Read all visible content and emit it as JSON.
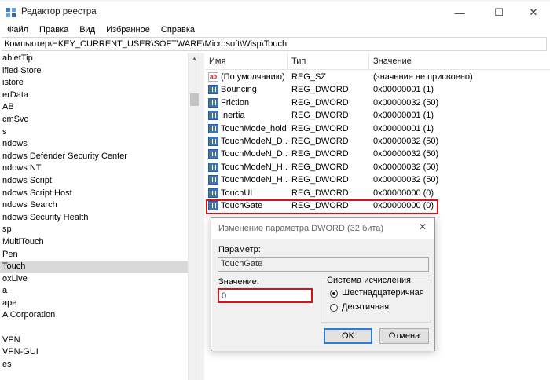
{
  "window": {
    "title": "Редактор реестра",
    "controls": {
      "minimize": "—",
      "maximize": "☐",
      "close": "✕"
    }
  },
  "menu": [
    "Файл",
    "Правка",
    "Вид",
    "Избранное",
    "Справка"
  ],
  "address": "Компьютер\\HKEY_CURRENT_USER\\SOFTWARE\\Microsoft\\Wisp\\Touch",
  "tree": {
    "items": [
      "abletTip",
      "ified Store",
      "istore",
      "erData",
      "AB",
      "cmSvc",
      "s",
      "ndows",
      "ndows Defender Security Center",
      "ndows NT",
      "ndows Script",
      "ndows Script Host",
      "ndows Search",
      "ndows Security Health",
      "sp",
      "MultiTouch",
      "Pen",
      "Touch",
      "oxLive",
      "a",
      "ape",
      "A Corporation",
      "",
      "VPN",
      "VPN-GUI",
      "es"
    ],
    "selected_index": 17
  },
  "list": {
    "headers": {
      "name": "Имя",
      "type": "Тип",
      "value": "Значение"
    },
    "rows": [
      {
        "icon": "string-value-icon",
        "name": "(По умолчанию)",
        "type": "REG_SZ",
        "value": "(значение не присвоено)"
      },
      {
        "icon": "dword-value-icon",
        "name": "Bouncing",
        "type": "REG_DWORD",
        "value": "0x00000001 (1)"
      },
      {
        "icon": "dword-value-icon",
        "name": "Friction",
        "type": "REG_DWORD",
        "value": "0x00000032 (50)"
      },
      {
        "icon": "dword-value-icon",
        "name": "Inertia",
        "type": "REG_DWORD",
        "value": "0x00000001 (1)"
      },
      {
        "icon": "dword-value-icon",
        "name": "TouchMode_hold",
        "type": "REG_DWORD",
        "value": "0x00000001 (1)"
      },
      {
        "icon": "dword-value-icon",
        "name": "TouchModeN_D...",
        "type": "REG_DWORD",
        "value": "0x00000032 (50)"
      },
      {
        "icon": "dword-value-icon",
        "name": "TouchModeN_D...",
        "type": "REG_DWORD",
        "value": "0x00000032 (50)"
      },
      {
        "icon": "dword-value-icon",
        "name": "TouchModeN_H...",
        "type": "REG_DWORD",
        "value": "0x00000032 (50)"
      },
      {
        "icon": "dword-value-icon",
        "name": "TouchModeN_H...",
        "type": "REG_DWORD",
        "value": "0x00000032 (50)"
      },
      {
        "icon": "dword-value-icon",
        "name": "TouchUI",
        "type": "REG_DWORD",
        "value": "0x00000000 (0)"
      },
      {
        "icon": "dword-value-icon",
        "name": "TouchGate",
        "type": "REG_DWORD",
        "value": "0x00000000 (0)"
      }
    ]
  },
  "dialog": {
    "title": "Изменение параметра DWORD (32 бита)",
    "param_label": "Параметр:",
    "param_value": "TouchGate",
    "value_label": "Значение:",
    "value": "0",
    "base_group": "Система исчисления",
    "radio_hex": "Шестнадцатеричная",
    "radio_dec": "Десятичная",
    "selected_base": "hex",
    "ok": "OK",
    "cancel": "Отмена"
  },
  "colors": {
    "highlight_red": "#d5141a",
    "selection_gray": "#d9d9d9",
    "dialog_body": "#f0f0f0",
    "button_default_border": "#2d7bd4"
  }
}
